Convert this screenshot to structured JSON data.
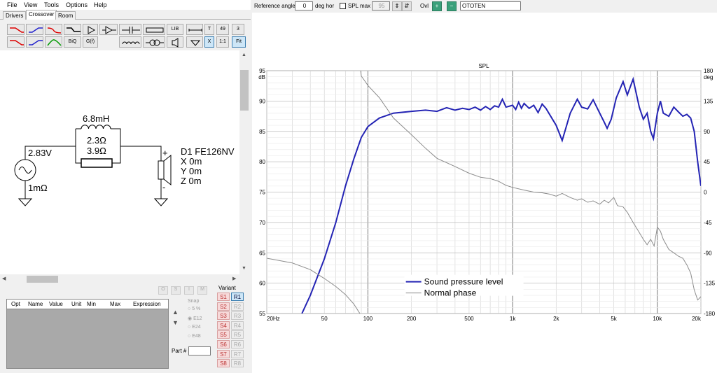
{
  "menu": [
    "File",
    "View",
    "Tools",
    "Options",
    "Help"
  ],
  "tabs": [
    "Drivers",
    "Crossover",
    "Room"
  ],
  "toolbar": {
    "biq": "BiQ",
    "gfil": "G(f)",
    "lib": "LIB",
    "t": "T",
    "n49": "49",
    "n3": "3",
    "x": "X",
    "ratio": "1:1",
    "fit": "Fit"
  },
  "schematic": {
    "source_v": "2.83V",
    "source_r": "1mΩ",
    "inductor": "6.8mH",
    "ind_r": "2.3Ω",
    "resistor": "3.9Ω",
    "driver_name": "D1 FE126NV",
    "x": "X 0m",
    "y": "Y 0m",
    "z": "Z 0m",
    "plus": "+",
    "minus": "-"
  },
  "lower": {
    "cols": [
      "Opt",
      "Name",
      "Value",
      "Unit",
      "Min",
      "Max",
      "Expression"
    ],
    "toolbtns": [
      "O",
      "S",
      "I",
      "M"
    ],
    "snap_label": "Snap",
    "snap_options": [
      "5 %",
      "E12",
      "E24",
      "E48"
    ],
    "part_label": "Part #",
    "variant_label": "Variant",
    "s_items": [
      "S1",
      "S2",
      "S3",
      "S4",
      "S5",
      "S6",
      "S7",
      "S8"
    ],
    "r_items": [
      "R1",
      "R2",
      "R3",
      "R4",
      "R5",
      "R6",
      "R7",
      "R8"
    ]
  },
  "graph_top": {
    "ref_label": "Reference angle",
    "ref_value": "0",
    "deg_hor": "deg hor",
    "spl_label": "SPL max",
    "spl_value": "95",
    "ovl_label": "Ovl",
    "name_value": "OTOTEN"
  },
  "chart_data": {
    "type": "line",
    "title": "SPL",
    "y_left_unit": "dB",
    "y_right_unit": "deg",
    "ylim": [
      55,
      95
    ],
    "y_right_lim": [
      -180,
      180
    ],
    "x_scale": "log",
    "xlim": [
      20,
      20000
    ],
    "y_ticks": [
      55,
      60,
      65,
      70,
      75,
      80,
      85,
      90,
      95
    ],
    "y_right_ticks": [
      -180,
      -135,
      -90,
      -45,
      0,
      45,
      90,
      135,
      180
    ],
    "x_ticks": [
      "20Hz",
      "50",
      "100",
      "200",
      "500",
      "1k",
      "2k",
      "5k",
      "10k",
      "20k"
    ],
    "x_tick_values": [
      20,
      50,
      100,
      200,
      500,
      1000,
      2000,
      5000,
      10000,
      20000
    ],
    "grid": true,
    "legend_placement": "bottom-center",
    "series": [
      {
        "name": "Sound pressure level",
        "color": "#2424b4",
        "axis": "left",
        "points": [
          [
            35,
            55
          ],
          [
            40,
            58
          ],
          [
            50,
            64
          ],
          [
            60,
            70
          ],
          [
            70,
            76
          ],
          [
            80,
            80.5
          ],
          [
            90,
            84
          ],
          [
            100,
            85.8
          ],
          [
            120,
            87.2
          ],
          [
            150,
            88
          ],
          [
            200,
            88.3
          ],
          [
            250,
            88.5
          ],
          [
            300,
            88.3
          ],
          [
            350,
            88.9
          ],
          [
            400,
            88.5
          ],
          [
            450,
            88.8
          ],
          [
            500,
            88.6
          ],
          [
            550,
            89
          ],
          [
            600,
            88.5
          ],
          [
            650,
            89.1
          ],
          [
            700,
            88.6
          ],
          [
            750,
            89.2
          ],
          [
            800,
            89
          ],
          [
            850,
            90.3
          ],
          [
            900,
            89
          ],
          [
            1000,
            89.3
          ],
          [
            1050,
            88.6
          ],
          [
            1100,
            89.8
          ],
          [
            1150,
            88.8
          ],
          [
            1200,
            89.6
          ],
          [
            1300,
            88.8
          ],
          [
            1400,
            89.3
          ],
          [
            1500,
            88.1
          ],
          [
            1600,
            89.5
          ],
          [
            1700,
            88.8
          ],
          [
            2000,
            86
          ],
          [
            2200,
            83.5
          ],
          [
            2500,
            88
          ],
          [
            2800,
            90.3
          ],
          [
            3000,
            89
          ],
          [
            3300,
            88.7
          ],
          [
            3600,
            90.2
          ],
          [
            4000,
            88
          ],
          [
            4300,
            86.5
          ],
          [
            4500,
            85.5
          ],
          [
            4800,
            87
          ],
          [
            5200,
            90.5
          ],
          [
            5800,
            93.2
          ],
          [
            6200,
            91
          ],
          [
            6800,
            93.6
          ],
          [
            7500,
            89
          ],
          [
            8000,
            87
          ],
          [
            8500,
            88
          ],
          [
            9000,
            85
          ],
          [
            9400,
            83.8
          ],
          [
            10000,
            88
          ],
          [
            10500,
            90
          ],
          [
            11000,
            88
          ],
          [
            12000,
            87.5
          ],
          [
            13000,
            89
          ],
          [
            14000,
            88.2
          ],
          [
            15000,
            87.5
          ],
          [
            16000,
            87.8
          ],
          [
            17000,
            87.2
          ],
          [
            18000,
            85
          ],
          [
            19000,
            80
          ],
          [
            20000,
            76
          ]
        ]
      },
      {
        "name": "Normal phase",
        "color": "#8c8c8c",
        "axis": "right",
        "points": [
          [
            20,
            -98
          ],
          [
            30,
            -105
          ],
          [
            40,
            -115
          ],
          [
            50,
            -128
          ],
          [
            60,
            -140
          ],
          [
            70,
            -152
          ],
          [
            80,
            -166
          ],
          [
            85,
            -175
          ],
          [
            88,
            -180
          ],
          [
            89,
            180
          ],
          [
            90,
            172
          ],
          [
            95,
            165
          ],
          [
            100,
            158
          ],
          [
            120,
            140
          ],
          [
            150,
            110
          ],
          [
            200,
            85
          ],
          [
            250,
            65
          ],
          [
            300,
            50
          ],
          [
            400,
            38
          ],
          [
            500,
            28
          ],
          [
            600,
            22
          ],
          [
            700,
            20
          ],
          [
            800,
            16
          ],
          [
            900,
            10
          ],
          [
            1000,
            7
          ],
          [
            1200,
            3
          ],
          [
            1400,
            0
          ],
          [
            1600,
            -1
          ],
          [
            1800,
            -3
          ],
          [
            2000,
            -6
          ],
          [
            2200,
            -2
          ],
          [
            2500,
            -8
          ],
          [
            2800,
            -12
          ],
          [
            3000,
            -10
          ],
          [
            3300,
            -15
          ],
          [
            3600,
            -13
          ],
          [
            4000,
            -18
          ],
          [
            4300,
            -12
          ],
          [
            4600,
            -16
          ],
          [
            5000,
            -8
          ],
          [
            5300,
            -20
          ],
          [
            5800,
            -22
          ],
          [
            6200,
            -30
          ],
          [
            6800,
            -45
          ],
          [
            7500,
            -60
          ],
          [
            8000,
            -70
          ],
          [
            8500,
            -78
          ],
          [
            9000,
            -70
          ],
          [
            9500,
            -80
          ],
          [
            10000,
            -52
          ],
          [
            10500,
            -58
          ],
          [
            11000,
            -70
          ],
          [
            12000,
            -85
          ],
          [
            13000,
            -90
          ],
          [
            14000,
            -95
          ],
          [
            15000,
            -98
          ],
          [
            16000,
            -108
          ],
          [
            17000,
            -120
          ],
          [
            18000,
            -145
          ],
          [
            19000,
            -160
          ],
          [
            20000,
            -155
          ]
        ]
      }
    ]
  }
}
